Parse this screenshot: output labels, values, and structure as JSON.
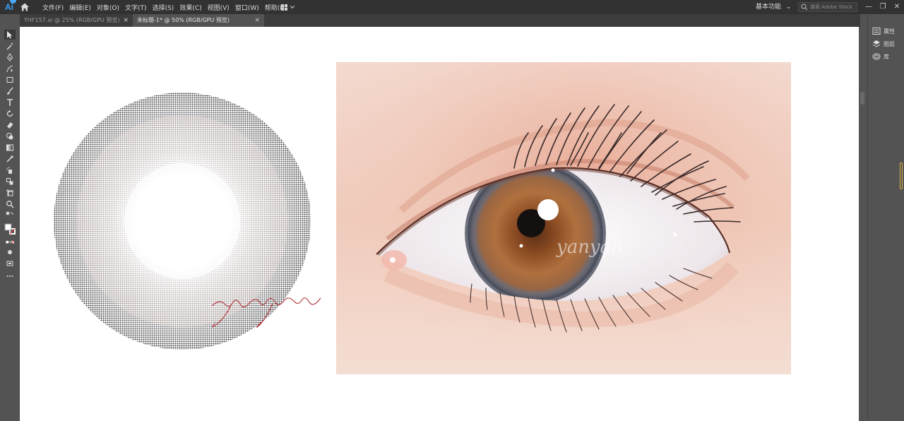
{
  "app": {
    "logo_text": "Ai",
    "menus": [
      "文件(F)",
      "编辑(E)",
      "对象(O)",
      "文字(T)",
      "选择(S)",
      "效果(C)",
      "视图(V)",
      "窗口(W)",
      "帮助(H)"
    ],
    "workspace_label": "基本功能",
    "stock_placeholder": "搜索 Adobe Stock",
    "window_controls": {
      "minimize": "—",
      "restore": "❐",
      "close": "✕"
    }
  },
  "tabs": [
    {
      "label": "YHF157.ai @ 25% (RGB/GPU 预览)",
      "close": "×"
    },
    {
      "label": "未标题-1* @ 50% (RGB/GPU 预览)",
      "close": "×"
    }
  ],
  "right_panel": {
    "items": [
      {
        "label": "属性",
        "icon": "properties-icon"
      },
      {
        "label": "图层",
        "icon": "layers-icon"
      },
      {
        "label": "库",
        "icon": "libraries-icon"
      }
    ]
  },
  "artwork": {
    "watermark": "yanyan",
    "colors": {
      "iris_brown": "#9a5a2e",
      "lens_ring": "#5e6470",
      "skin": "#f2cbbd",
      "signature_red": "#b0343a"
    }
  }
}
